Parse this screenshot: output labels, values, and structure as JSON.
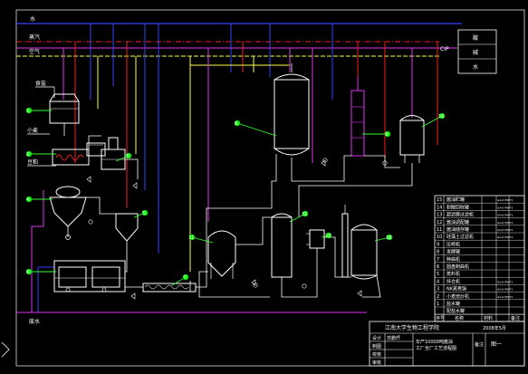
{
  "utilities": {
    "water": "水",
    "steam": "蒸汽",
    "air": "空气",
    "wastewater": "废水",
    "cip": "CIP",
    "cip_acid": "酸",
    "cip_alkali": "碱",
    "cip_water": "水"
  },
  "inputs": {
    "salt": "食盐",
    "wheat": "小麦",
    "soybean": "豆粕"
  },
  "callouts": [
    "1",
    "2",
    "3",
    "4",
    "5",
    "6",
    "7",
    "8",
    "9",
    "10",
    "11",
    "12",
    "13",
    "14",
    "15",
    "16"
  ],
  "parts_list": [
    {
      "no": "15",
      "name": "酱油贮罐",
      "tag": "GA-6 PM/T1"
    },
    {
      "no": "14",
      "name": "耐酸回收罐",
      "tag": "GA-6 PM/T1"
    },
    {
      "no": "13",
      "name": "超滤膜过滤机",
      "tag": "GA-6 PM/T1"
    },
    {
      "no": "12",
      "name": "酱油调配罐",
      "tag": "GA-6 PM/T1"
    },
    {
      "no": "11",
      "name": "酱油储存罐",
      "tag": "GA-6 PM/T1"
    },
    {
      "no": "10",
      "name": "硅藻土过滤机",
      "tag": "GA-6 PM/T1"
    },
    {
      "no": "9",
      "name": "压榨机",
      "tag": ""
    },
    {
      "no": "8",
      "name": "发酵罐",
      "tag": ""
    },
    {
      "no": "7",
      "name": "种曲机",
      "tag": ""
    },
    {
      "no": "6",
      "name": "圆盘制曲机",
      "tag": ""
    },
    {
      "no": "5",
      "name": "蒸料机",
      "tag": ""
    },
    {
      "no": "4",
      "name": "拌合机",
      "tag": "GA-6 PM/T1"
    },
    {
      "no": "3",
      "name": "NK蒸煮锅",
      "tag": "GA-6 PM/T1"
    },
    {
      "no": "2",
      "name": "小麦焙炒机",
      "tag": "GA-6 PM/T1"
    },
    {
      "no": "1",
      "name": "盐水罐",
      "tag": ""
    },
    {
      "no": "",
      "name": "配盐水罐",
      "tag": ""
    }
  ],
  "parts_header": {
    "no": "序号",
    "name": "名称",
    "qty": "",
    "material": "材料",
    "note": "备注"
  },
  "title_block": {
    "school": "江南大学生物工程学院",
    "date": "2008年5月",
    "design": "设计",
    "draw": "制图",
    "check": "校核",
    "review": "审核",
    "designer": "苏鹏玕",
    "title": "年产10000吨酱油工厂全厂工艺流程图",
    "note": "备注",
    "sheet": "图一"
  },
  "colors": {
    "water_line": "#3344ff",
    "steam_line": "#ee2222",
    "air_line": "#ffff44",
    "magenta_line": "#dd33ee",
    "green_leader": "#33ee33",
    "equipment": "#ffffff"
  }
}
